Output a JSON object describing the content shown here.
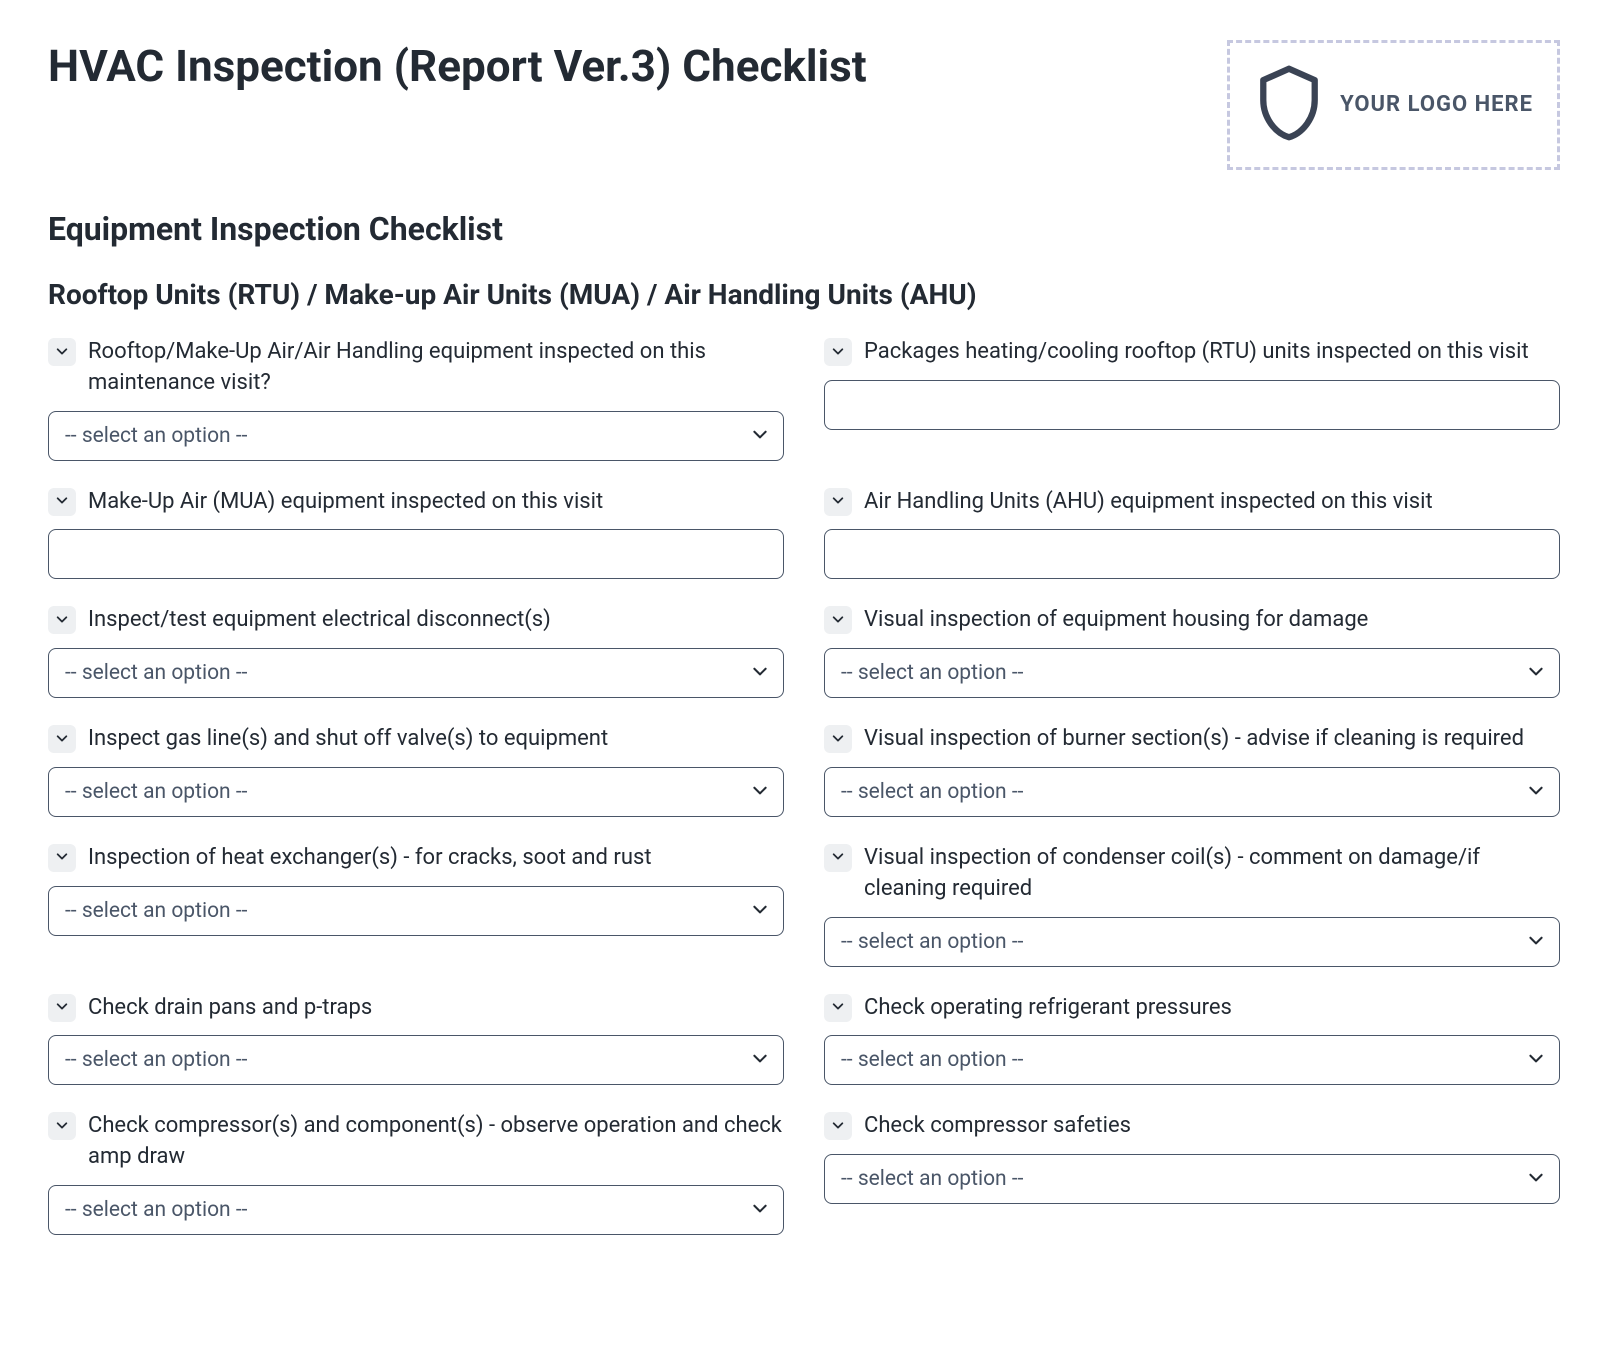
{
  "main_title": "HVAC Inspection (Report Ver.3) Checklist",
  "logo_placeholder": "YOUR LOGO HERE",
  "section_title": "Equipment Inspection Checklist",
  "subsection_title": "Rooftop Units (RTU) / Make-up Air Units (MUA) / Air Handling Units (AHU)",
  "placeholder_select": "-- select an option --",
  "fields": {
    "f0": {
      "label": "Rooftop/Make-Up Air/Air Handling equipment inspected on this maintenance visit?",
      "type": "select"
    },
    "f1": {
      "label": "Packages heating/cooling rooftop (RTU) units inspected on this visit",
      "type": "text"
    },
    "f2": {
      "label": "Make-Up Air (MUA) equipment inspected on this visit",
      "type": "text"
    },
    "f3": {
      "label": "Air Handling Units (AHU) equipment inspected on this visit",
      "type": "text"
    },
    "f4": {
      "label": "Inspect/test equipment electrical disconnect(s)",
      "type": "select"
    },
    "f5": {
      "label": "Visual inspection of equipment housing for damage",
      "type": "select"
    },
    "f6": {
      "label": "Inspect gas line(s) and shut off valve(s) to equipment",
      "type": "select"
    },
    "f7": {
      "label": "Visual inspection of burner section(s) - advise if cleaning is required",
      "type": "select"
    },
    "f8": {
      "label": "Inspection of heat exchanger(s) - for cracks, soot and rust",
      "type": "select"
    },
    "f9": {
      "label": "Visual inspection of condenser coil(s) - comment on damage/if cleaning required",
      "type": "select"
    },
    "f10": {
      "label": "Check drain pans and p-traps",
      "type": "select"
    },
    "f11": {
      "label": "Check operating refrigerant pressures",
      "type": "select"
    },
    "f12": {
      "label": "Check compressor(s) and component(s) - observe operation and check amp draw",
      "type": "select"
    },
    "f13": {
      "label": "Check compressor safeties",
      "type": "select"
    }
  }
}
